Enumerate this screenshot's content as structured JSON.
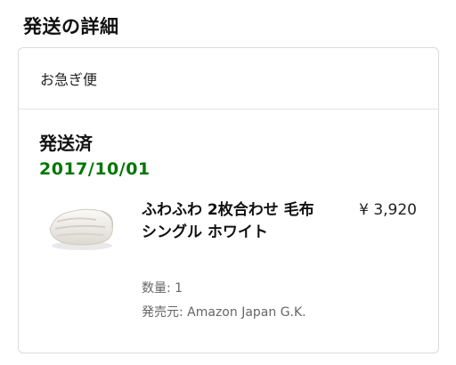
{
  "section": {
    "title": "発送の詳細"
  },
  "shipment": {
    "speed": "お急ぎ便",
    "status": "発送済",
    "date": "2017/10/01",
    "date_color": "#007600"
  },
  "item": {
    "title": "ふわふわ 2枚合わせ 毛布 シングル ホワイト",
    "price": "¥ 3,920",
    "quantity": "数量: 1",
    "seller": "発売元: Amazon Japan G.K.",
    "thumbnail_icon": "white-blanket-image"
  }
}
